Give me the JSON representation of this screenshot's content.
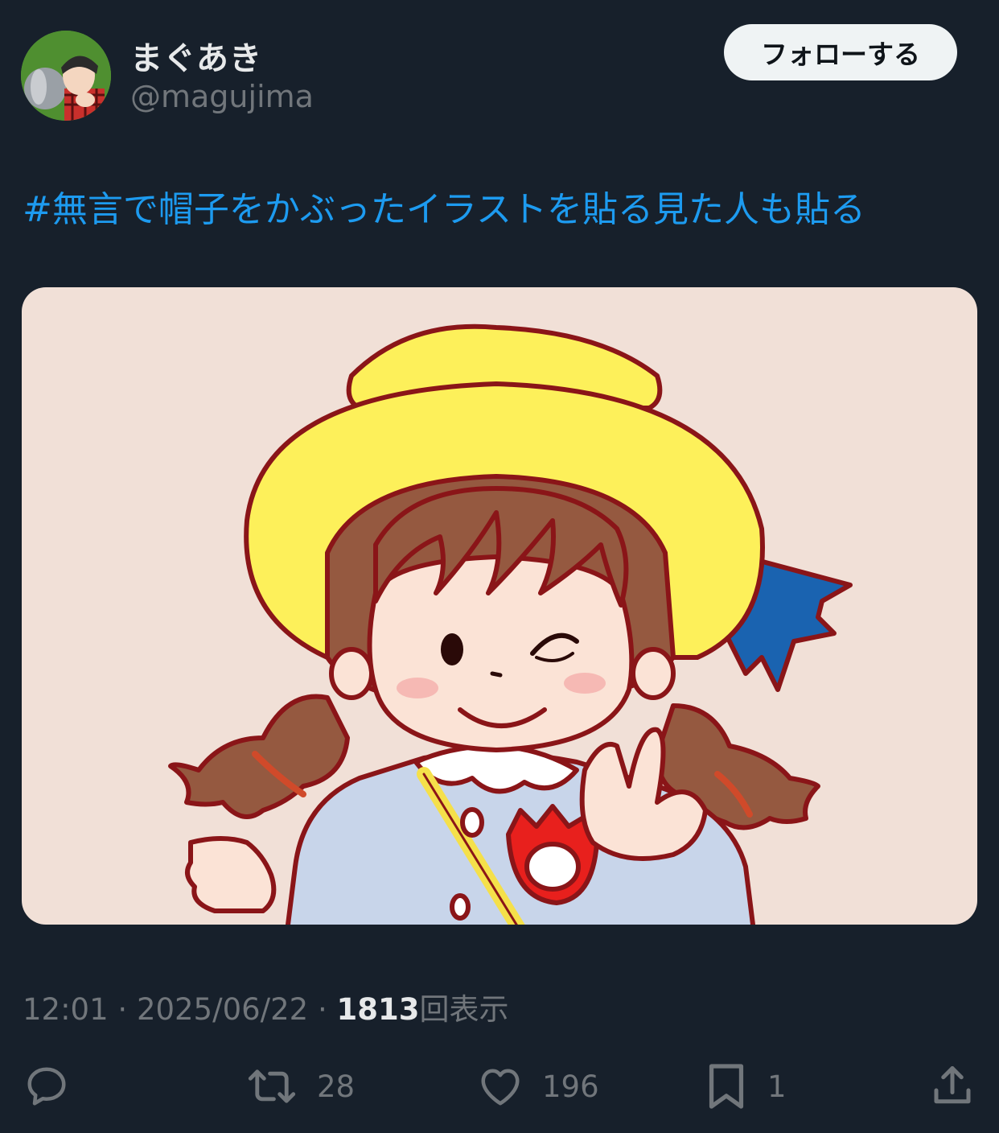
{
  "author": {
    "display_name": "まぐあき",
    "handle": "@magujima"
  },
  "follow_label": "フォローする",
  "post": {
    "hashtag": "#無言で帽子をかぶったイラストを貼る見た人も貼る",
    "time": "12:01",
    "separator": "·",
    "date": "2025/06/22",
    "views_count": "1813",
    "views_label": "回表示"
  },
  "actions": {
    "reply_icon": "reply-icon",
    "retweets": "28",
    "likes": "196",
    "bookmarks": "1",
    "share_icon": "share-icon"
  },
  "colors": {
    "background": "#17202b",
    "link": "#1d9bf0",
    "secondary_text": "#71767b",
    "image_background": "#f1e0d7"
  }
}
